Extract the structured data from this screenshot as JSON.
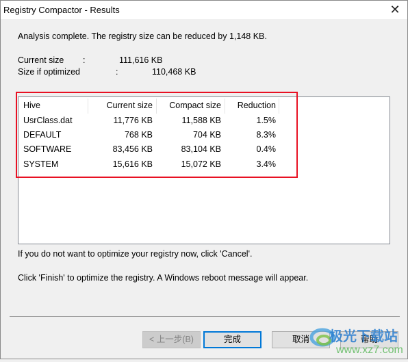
{
  "window": {
    "title": "Registry Compactor - Results"
  },
  "summary": {
    "message": "Analysis complete. The registry size can be reduced by 1,148 KB.",
    "current_label": "Current size",
    "current_colon": ":",
    "current_value": "111,616 KB",
    "optimized_label": "Size if optimized",
    "optimized_colon": ":",
    "optimized_value": "110,468 KB"
  },
  "table": {
    "headers": [
      "Hive",
      "Current size",
      "Compact size",
      "Reduction"
    ],
    "rows": [
      [
        "UsrClass.dat",
        "11,776 KB",
        "11,588 KB",
        "1.5%"
      ],
      [
        "DEFAULT",
        "768 KB",
        "704 KB",
        "8.3%"
      ],
      [
        "SOFTWARE",
        "83,456 KB",
        "83,104 KB",
        "0.4%"
      ],
      [
        "SYSTEM",
        "15,616 KB",
        "15,072 KB",
        "3.4%"
      ]
    ]
  },
  "notes": {
    "cancel_note": "If you do not want to optimize your registry now, click 'Cancel'.",
    "finish_note": "Click 'Finish' to optimize the registry. A Windows reboot message will appear."
  },
  "buttons": {
    "back": "< 上一步(B)",
    "finish": "完成",
    "cancel": "取消",
    "help": "帮助"
  },
  "watermark": {
    "name": "极光下载站",
    "url": "www.xz7.com"
  },
  "colors": {
    "highlight": "#e81123",
    "default_button": "#0078d7"
  }
}
